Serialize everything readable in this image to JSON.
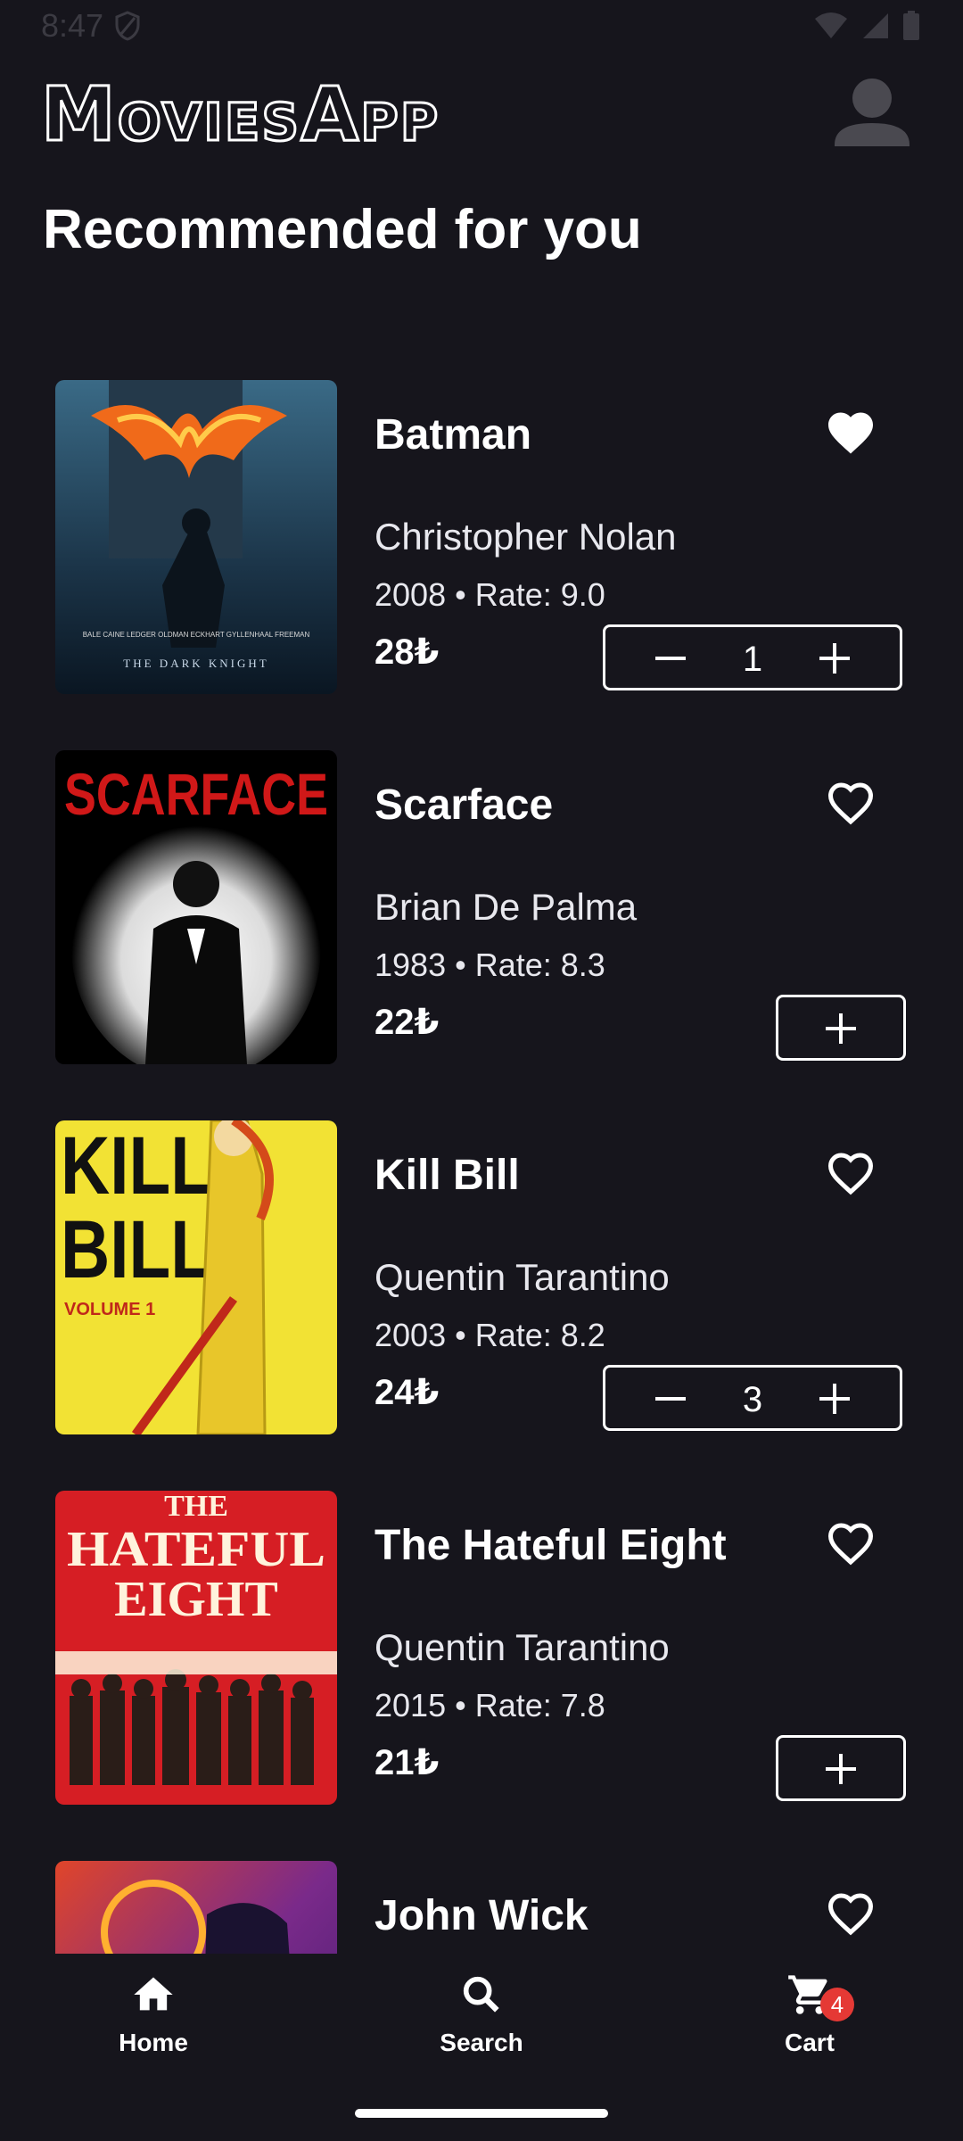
{
  "status_bar": {
    "time": "8:47"
  },
  "header": {
    "logo_parts": [
      "M",
      "OVIES",
      "A",
      "PP"
    ],
    "avatar_icon": "account-circle-icon"
  },
  "section_title": "Recommended for you",
  "movies": [
    {
      "title": "Batman",
      "director": "Christopher Nolan",
      "meta": "2008 • Rate: 9.0",
      "price": "28₺",
      "favorite": true,
      "quantity": "1"
    },
    {
      "title": "Scarface",
      "director": "Brian De Palma",
      "meta": "1983 • Rate: 8.3",
      "price": "22₺",
      "favorite": false
    },
    {
      "title": "Kill Bill",
      "director": "Quentin Tarantino",
      "meta": "2003 • Rate: 8.2",
      "price": "24₺",
      "favorite": false,
      "quantity": "3"
    },
    {
      "title": "The Hateful Eight",
      "director": "Quentin Tarantino",
      "meta": "2015 • Rate: 7.8",
      "price": "21₺",
      "favorite": false
    },
    {
      "title": "John Wick",
      "favorite": false
    }
  ],
  "posters": {
    "batman": {
      "cast_line": "BALE  CAINE  LEDGER  OLDMAN  ECKHART  GYLLENHAAL  FREEMAN",
      "title_line": "THE DARK KNIGHT"
    },
    "scarface": {
      "title_line": "SCARFACE"
    },
    "killbill": {
      "line1": "KILL",
      "line2": "BILL",
      "line3": "VOLUME 1"
    },
    "hateful": {
      "line1": "THE",
      "line2": "HATEFUL",
      "line3": "EIGHT"
    }
  },
  "bottom_nav": {
    "home": "Home",
    "search": "Search",
    "cart": "Cart",
    "cart_count": "4"
  },
  "colors": {
    "background": "#16151c",
    "badge": "#e53935",
    "foreground": "#ffffff"
  }
}
